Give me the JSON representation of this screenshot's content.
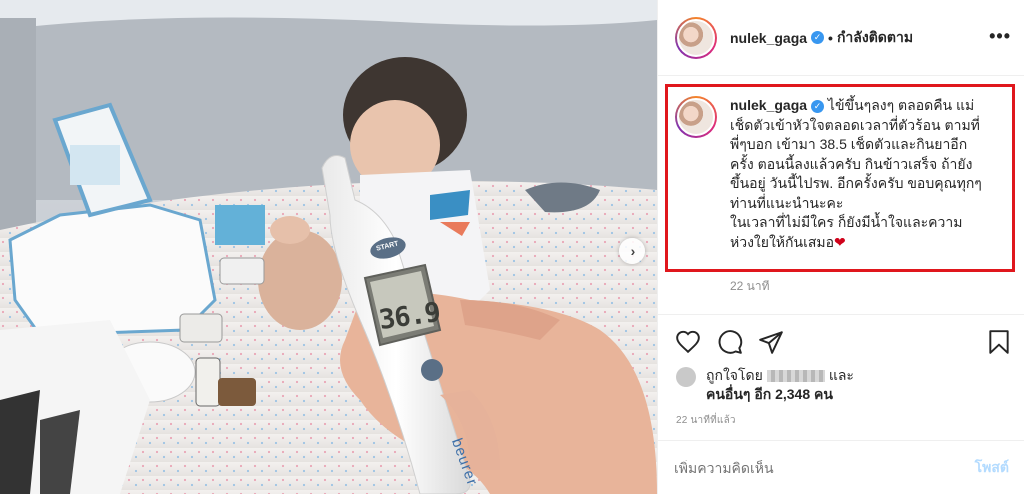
{
  "header": {
    "username": "nulek_gaga",
    "separator": "•",
    "follow_label": "กำลังติดตาม",
    "more_icon": "more-horizontal-icon"
  },
  "photo": {
    "thermometer_brand": "beurer",
    "thermometer_reading": "36.9",
    "thermometer_button": "START",
    "next_icon": "chevron-right-icon"
  },
  "caption": {
    "username": "nulek_gaga",
    "lines": [
      "ไข้ขึ้นๆลงๆ ตลอดคืน แม่",
      "เช็ดตัวเข้าหัวใจตลอดเวลาที่ตัวร้อน ตามที่",
      "พี่ๆบอก เข้ามา 38.5 เช็ดตัวและกินยาอีก",
      "ครั้ง ตอนนี้ลงแล้วครับ กินข้าวเสร็จ ถ้ายัง",
      "ขึ้นอยู่ วันนี้ไปรพ. อีกครั้งครับ ขอบคุณทุกๆ",
      "ท่านที่แนะนำนะคะ",
      "ในเวลาที่ไม่มีใคร ก็ยังมีน้ำใจและความ",
      "ห่วงใยให้กันเสมอ"
    ],
    "emoji": "❤",
    "time": "22 นาที"
  },
  "actions": {
    "like_icon": "heart-icon",
    "comment_icon": "comment-icon",
    "share_icon": "share-icon",
    "save_icon": "bookmark-icon"
  },
  "likes": {
    "prefix": "ถูกใจโดย",
    "and": "และ",
    "others": "คนอื่นๆ อีก 2,348 คน"
  },
  "timestamp": "22 นาทีที่แล้ว",
  "comment": {
    "placeholder": "เพิ่มความคิดเห็น",
    "post_label": "โพสต์"
  },
  "colors": {
    "highlight_border": "#e0171d",
    "verified": "#3897f0",
    "post_button": "#b3dbff"
  }
}
